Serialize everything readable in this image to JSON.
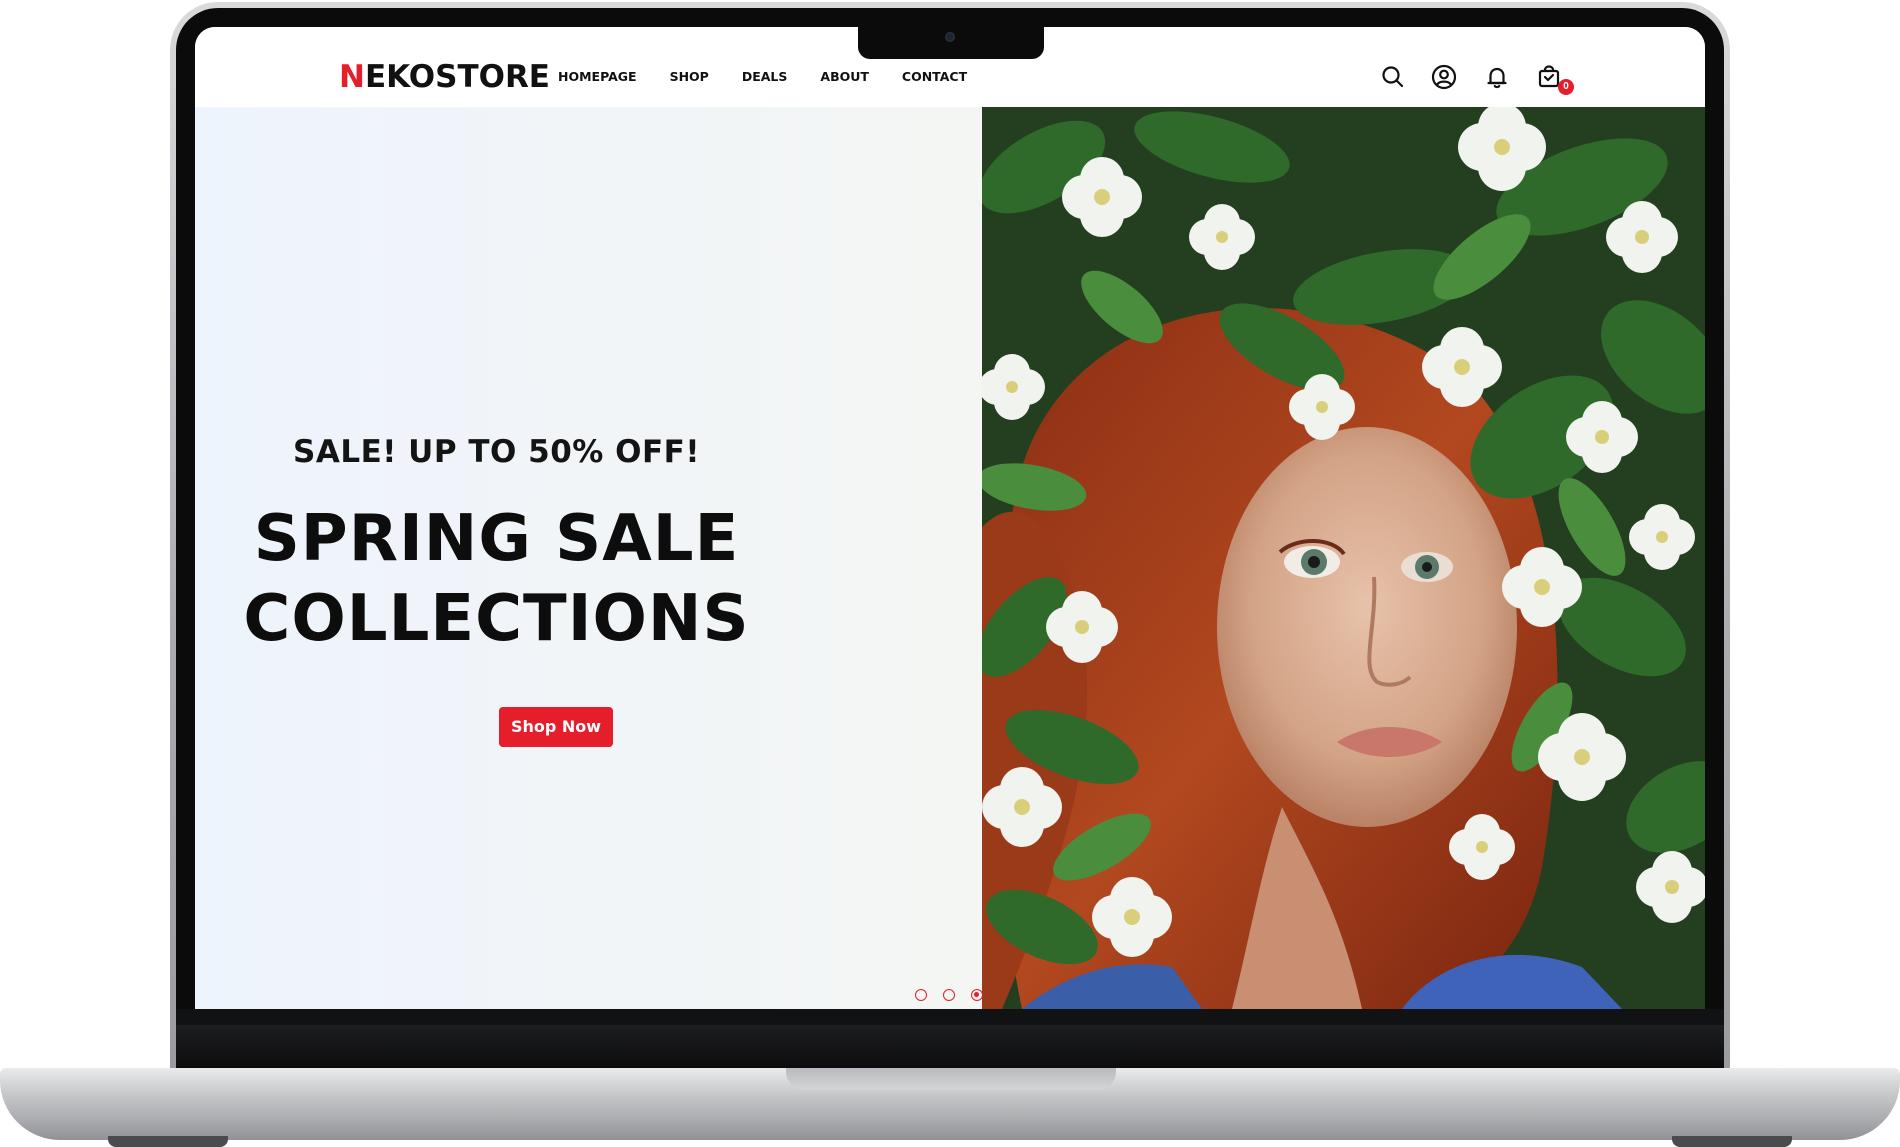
{
  "site": {
    "logo_first_letter": "N",
    "logo_rest": "EKOSTORE"
  },
  "nav": {
    "items": [
      {
        "label": "HOMEPAGE"
      },
      {
        "label": "SHOP"
      },
      {
        "label": "DEALS"
      },
      {
        "label": "ABOUT"
      },
      {
        "label": "CONTACT"
      }
    ],
    "icons": [
      "search-icon",
      "user-icon",
      "bell-icon",
      "cart-icon"
    ],
    "cart_count": "0"
  },
  "hero": {
    "kicker": "SALE! UP TO 50% OFF!",
    "title_line1": "SPRING SALE",
    "title_line2": "COLLECTIONS",
    "cta_label": "Shop Now",
    "image_alt": "Red-haired woman surrounded by white jasmine flowers",
    "slides_total": 3,
    "active_slide": 3
  },
  "colors": {
    "accent": "#e61d2b",
    "text_dark": "#111111",
    "hero_bg": "#f2f5f7"
  }
}
